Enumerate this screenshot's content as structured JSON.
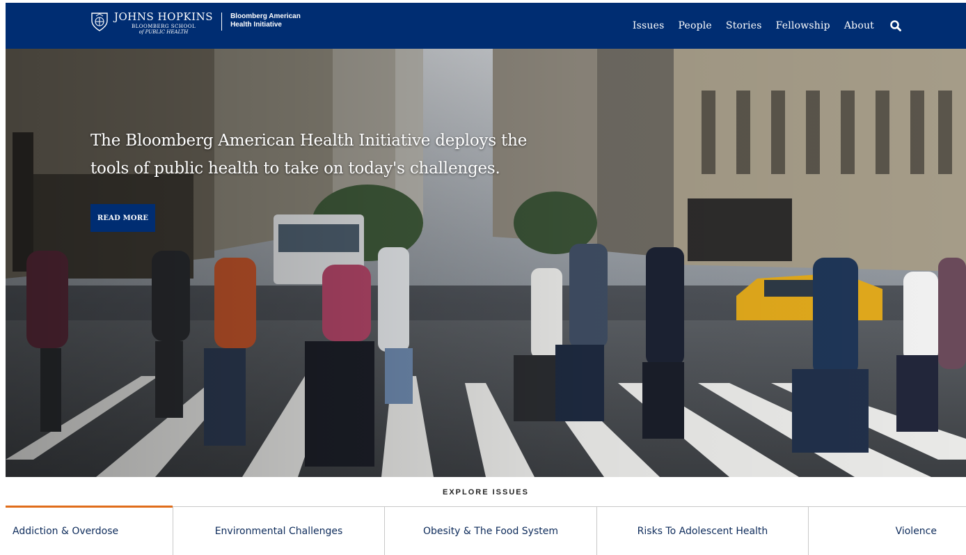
{
  "header": {
    "logo": {
      "university": "JOHNS HOPKINS",
      "school_line1": "BLOOMBERG SCHOOL",
      "school_line2": "of PUBLIC HEALTH",
      "initiative_line1": "Bloomberg American",
      "initiative_line2": "Health Initiative"
    },
    "nav": [
      "Issues",
      "People",
      "Stories",
      "Fellowship",
      "About"
    ],
    "search_icon": "search-icon"
  },
  "hero": {
    "headline_line1": "The Bloomberg American Health Initiative deploys the",
    "headline_line2": "tools of public health to take on today's challenges.",
    "button_label": "READ MORE"
  },
  "explore": {
    "title": "EXPLORE ISSUES",
    "tabs": [
      "Addiction & Overdose",
      "Environmental Challenges",
      "Obesity & The Food System",
      "Risks To Adolescent Health",
      "Violence"
    ]
  },
  "colors": {
    "brand_blue": "#002d72",
    "active_tab_accent": "#e06d1a",
    "tab_text": "#0c2a5a"
  }
}
